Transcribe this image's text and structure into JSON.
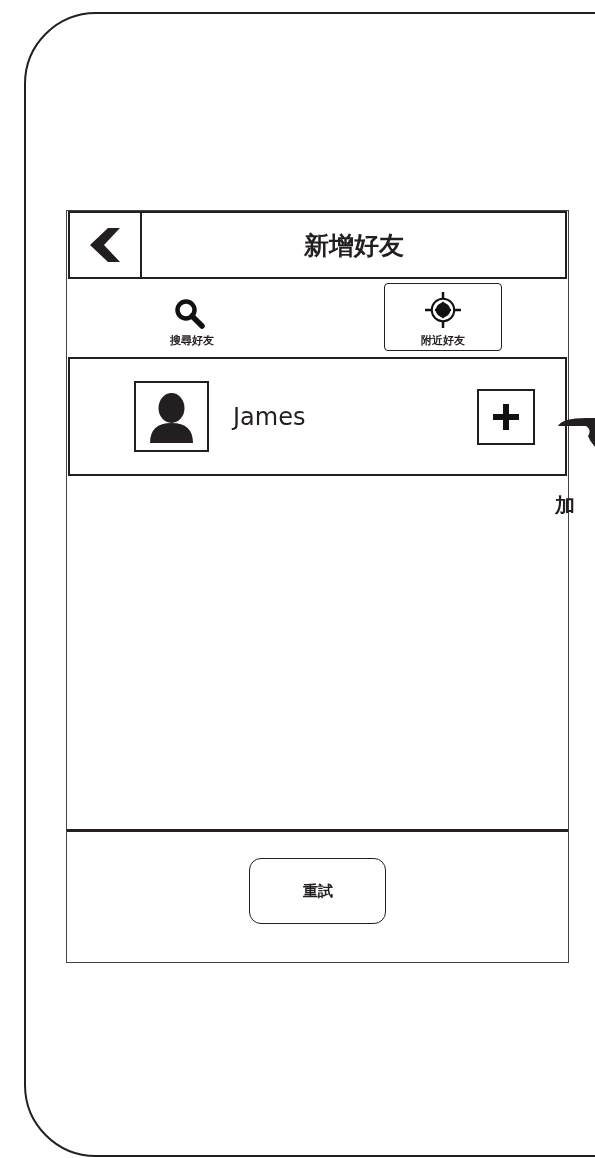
{
  "header": {
    "title": "新增好友"
  },
  "tabs": [
    {
      "label": "搜尋好友",
      "kind": "search",
      "selected": false
    },
    {
      "label": "附近好友",
      "kind": "nearby",
      "selected": true
    }
  ],
  "friends": [
    {
      "name": "James"
    }
  ],
  "retry_button": "重試",
  "annotation": {
    "label": "加"
  }
}
